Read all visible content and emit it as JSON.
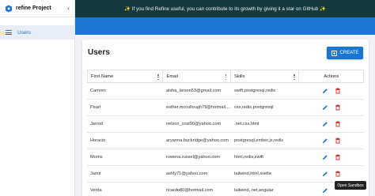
{
  "sidebar": {
    "app_title": "refine Project",
    "items": [
      {
        "label": "Users",
        "icon": "list-icon"
      }
    ]
  },
  "banner": {
    "text": "✨ If you find Refine useful, you can contribute to its growth by giving it a star on GitHub ✨"
  },
  "page": {
    "title": "Users",
    "create_label": "CREATE"
  },
  "table": {
    "columns": [
      "First Name",
      "Email",
      "Skills",
      "Actions"
    ],
    "rows": [
      {
        "first_name": "Camren",
        "email": "aisha_larson53@gmail.com",
        "skills": "swift,postgresql,redis"
      },
      {
        "first_name": "Pearl",
        "email": "esther.mccullough79@hotmail....",
        "skills": "css,redis,postgresql"
      },
      {
        "first_name": "Jarrod",
        "email": "nelson_crist90@yahoo.com",
        "skills": ".net,css,html"
      },
      {
        "first_name": "Horacio",
        "email": "aryanna.buckridge@yahoo.com",
        "skills": "postgresql,ember.js,redis"
      },
      {
        "first_name": "Morris",
        "email": "rowena.russel@yahoo.com",
        "skills": "html,redis,swift"
      },
      {
        "first_name": "Jamir",
        "email": "ashly71@yahoo.com",
        "skills": "tailwind,html,svelte"
      },
      {
        "first_name": "Verda",
        "email": "ricardo80@hotmail.com",
        "skills": "tailwind,.net,angular"
      }
    ]
  },
  "tooltip": {
    "text": "Open Sandbox"
  },
  "colors": {
    "primary": "#1976d2",
    "banner_bg": "#143a3d",
    "delete": "#d32f2f"
  }
}
